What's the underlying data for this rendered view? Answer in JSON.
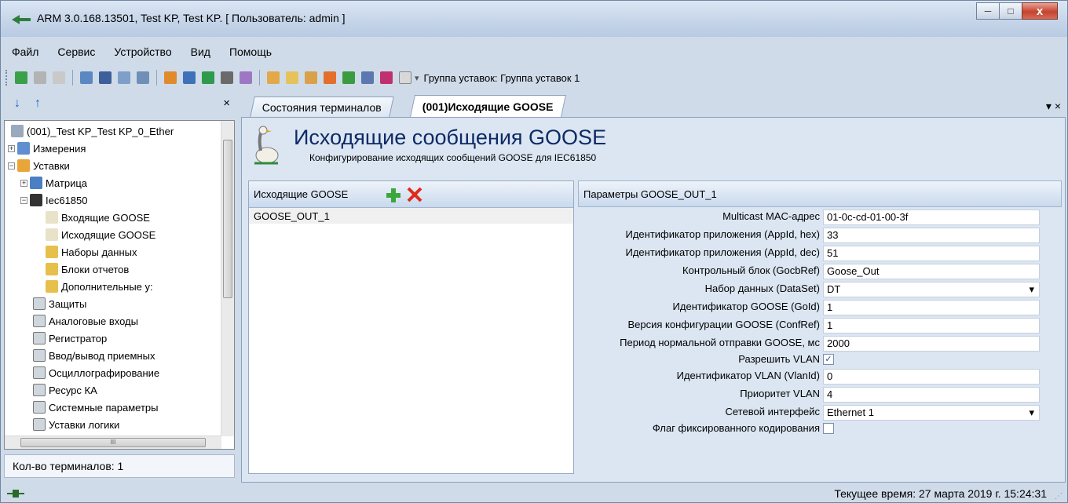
{
  "window": {
    "title": "ARM 3.0.168.13501, Test KP, Test KP. [ Пользователь: admin ]",
    "minimize": "─",
    "maximize": "□",
    "close": "x"
  },
  "menu": [
    "Файл",
    "Сервис",
    "Устройство",
    "Вид",
    "Помощь"
  ],
  "toolbar": {
    "group_label": "Группа уставок: Группа уставок 1",
    "dropdown_arrow": "▾"
  },
  "left_panel": {
    "up_arrow": "↓",
    "down_arrow": "↑",
    "close": "×",
    "tree": [
      {
        "label": "(001)_Test KP_Test KP_0_Ether",
        "expander": "",
        "icon": "terminal-icon"
      },
      {
        "label": "Измерения",
        "expander": "+",
        "icon": "measurements-icon"
      },
      {
        "label": "Уставки",
        "expander": "−",
        "icon": "settings-folder-icon"
      },
      {
        "label": "Матрица",
        "expander": "+",
        "icon": "matrix-icon"
      },
      {
        "label": "Iec61850",
        "expander": "−",
        "icon": "iec-icon"
      },
      {
        "label": "Входящие GOOSE",
        "expander": "",
        "icon": "goose-icon"
      },
      {
        "label": "Исходящие GOOSE",
        "expander": "",
        "icon": "goose-icon"
      },
      {
        "label": "Наборы данных",
        "expander": "",
        "icon": "dataset-icon"
      },
      {
        "label": "Блоки отчетов",
        "expander": "",
        "icon": "report-icon"
      },
      {
        "label": "Дополнительные у:",
        "expander": "",
        "icon": "additional-icon"
      },
      {
        "label": "Защиты",
        "expander": "",
        "icon": "table-icon"
      },
      {
        "label": "Аналоговые входы",
        "expander": "",
        "icon": "table-icon"
      },
      {
        "label": "Регистратор",
        "expander": "",
        "icon": "table-icon"
      },
      {
        "label": "Ввод/вывод приемных",
        "expander": "",
        "icon": "table-icon"
      },
      {
        "label": "Осциллографирование",
        "expander": "",
        "icon": "table-icon"
      },
      {
        "label": "Ресурс КА",
        "expander": "",
        "icon": "table-icon"
      },
      {
        "label": "Системные параметры",
        "expander": "",
        "icon": "table-icon"
      },
      {
        "label": "Уставки логики",
        "expander": "",
        "icon": "table-icon"
      }
    ],
    "hscroll_grip": "III",
    "footer": "Кол-во терминалов: 1"
  },
  "tabs": [
    {
      "label": "Состояния терминалов",
      "active": false
    },
    {
      "label": "(001)Исходящие GOOSE",
      "active": true
    }
  ],
  "tab_controls": "▾ ×",
  "header": {
    "title": "Исходящие сообщения GOOSE",
    "subtitle": "Конфигурирование исходящих сообщений GOOSE для IEC61850"
  },
  "goose_list": {
    "header": "Исходящие GOOSE",
    "items": [
      "GOOSE_OUT_1"
    ]
  },
  "params": {
    "header": "Параметры GOOSE_OUT_1",
    "rows": [
      {
        "label": "Multicast MAC-адрес",
        "value": "01-0c-cd-01-00-3f",
        "kind": "text"
      },
      {
        "label": "Идентификатор приложения (AppId, hex)",
        "value": "33",
        "kind": "text"
      },
      {
        "label": "Идентификатор приложения (AppId, dec)",
        "value": "51",
        "kind": "text"
      },
      {
        "label": "Контрольный блок (GocbRef)",
        "value": "Goose_Out",
        "kind": "text"
      },
      {
        "label": "Набор данных (DataSet)",
        "value": "DT",
        "kind": "dropdown"
      },
      {
        "label": "Идентификатор GOOSE (GoId)",
        "value": "1",
        "kind": "text"
      },
      {
        "label": "Версия конфигурации GOOSE (ConfRef)",
        "value": "1",
        "kind": "text"
      },
      {
        "label": "Период нормальной отправки GOOSE, мс",
        "value": "2000",
        "kind": "text"
      },
      {
        "label": "Разрешить VLAN",
        "value": "✓",
        "kind": "checkbox"
      },
      {
        "label": "Идентификатор VLAN (VlanId)",
        "value": "0",
        "kind": "text"
      },
      {
        "label": "Приоритет VLAN",
        "value": "4",
        "kind": "text"
      },
      {
        "label": "Сетевой интерфейс",
        "value": "Ethernet 1",
        "kind": "dropdown"
      },
      {
        "label": "Флаг фиксированного кодирования",
        "value": "",
        "kind": "checkbox"
      }
    ]
  },
  "status": {
    "time": "Текущее время: 27 марта 2019 г. 15:24:31"
  },
  "colors": {
    "accent": "#0e2a66",
    "frame": "#cfdbe9"
  }
}
